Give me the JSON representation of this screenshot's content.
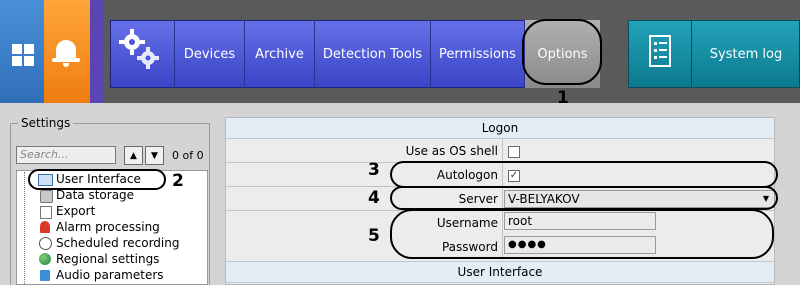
{
  "topbar": {
    "nav_items": [
      {
        "label": "Devices"
      },
      {
        "label": "Archive"
      },
      {
        "label": "Detection Tools"
      },
      {
        "label": "Permissions"
      },
      {
        "label": "Options"
      }
    ],
    "system_log_label": "System log",
    "icons": {
      "windows": "windows-icon",
      "alert": "bell-icon",
      "settings": "gears-icon",
      "log": "log-list-icon"
    },
    "colors": {
      "nav": "#4a55d8",
      "options": "#9a9a9a",
      "syslog": "#1b8fa5",
      "windows_tile": "#3d82cf",
      "alert_tile": "#f58a1f"
    }
  },
  "annotations": [
    "1",
    "2",
    "3",
    "4",
    "5"
  ],
  "settings": {
    "title": "Settings",
    "search_placeholder": "Search...",
    "count": "0 of 0",
    "tree": [
      {
        "label": "User Interface",
        "icon": "window-icon"
      },
      {
        "label": "Data storage",
        "icon": "storage-icon"
      },
      {
        "label": "Export",
        "icon": "export-icon"
      },
      {
        "label": "Alarm processing",
        "icon": "alarm-icon"
      },
      {
        "label": "Scheduled recording",
        "icon": "clock-icon"
      },
      {
        "label": "Regional settings",
        "icon": "globe-icon"
      },
      {
        "label": "Audio parameters",
        "icon": "audio-icon"
      }
    ]
  },
  "logon": {
    "header": "Logon",
    "use_as_os_shell": {
      "label": "Use as OS shell",
      "checked": false
    },
    "autologon": {
      "label": "Autologon",
      "checked": true
    },
    "server": {
      "label": "Server",
      "value": "V-BELYAKOV"
    },
    "username": {
      "label": "Username",
      "value": "root"
    },
    "password": {
      "label": "Password",
      "value": "●●●●"
    }
  },
  "user_interface_header": "User Interface"
}
